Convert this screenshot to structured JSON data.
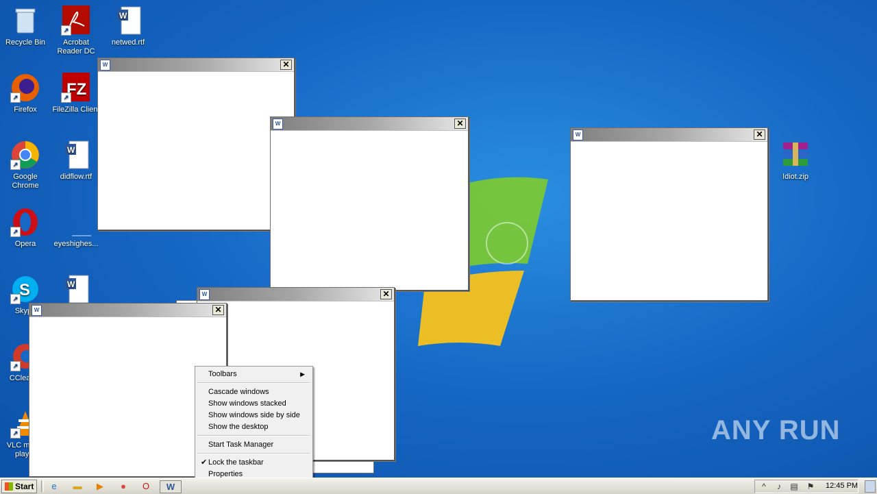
{
  "desktop_icons": [
    {
      "label": "Recycle Bin"
    },
    {
      "label": "Acrobat Reader DC"
    },
    {
      "label": "netwed.rtf"
    },
    {
      "label": "Firefox"
    },
    {
      "label": "FileZilla Client"
    },
    {
      "label": "Google Chrome"
    },
    {
      "label": "didflow.rtf"
    },
    {
      "label": "Opera"
    },
    {
      "label": "eyeshighes..."
    },
    {
      "label": "Skype"
    },
    {
      "label": "CCleaner"
    },
    {
      "label": "VLC media player"
    },
    {
      "label": "Idiot.zip"
    }
  ],
  "windows_count": 6,
  "context_menu": {
    "toolbars": "Toolbars",
    "cascade": "Cascade windows",
    "stacked": "Show windows stacked",
    "side_by_side": "Show windows side by side",
    "show_desktop": "Show the desktop",
    "task_manager": "Start Task Manager",
    "lock": "Lock the taskbar",
    "properties": "Properties"
  },
  "taskbar": {
    "start_label": "Start",
    "clock": "12:45 PM"
  },
  "watermark": "ANY RUN",
  "icons": {
    "close": "✕",
    "check": "✔",
    "submenu": "▶"
  }
}
